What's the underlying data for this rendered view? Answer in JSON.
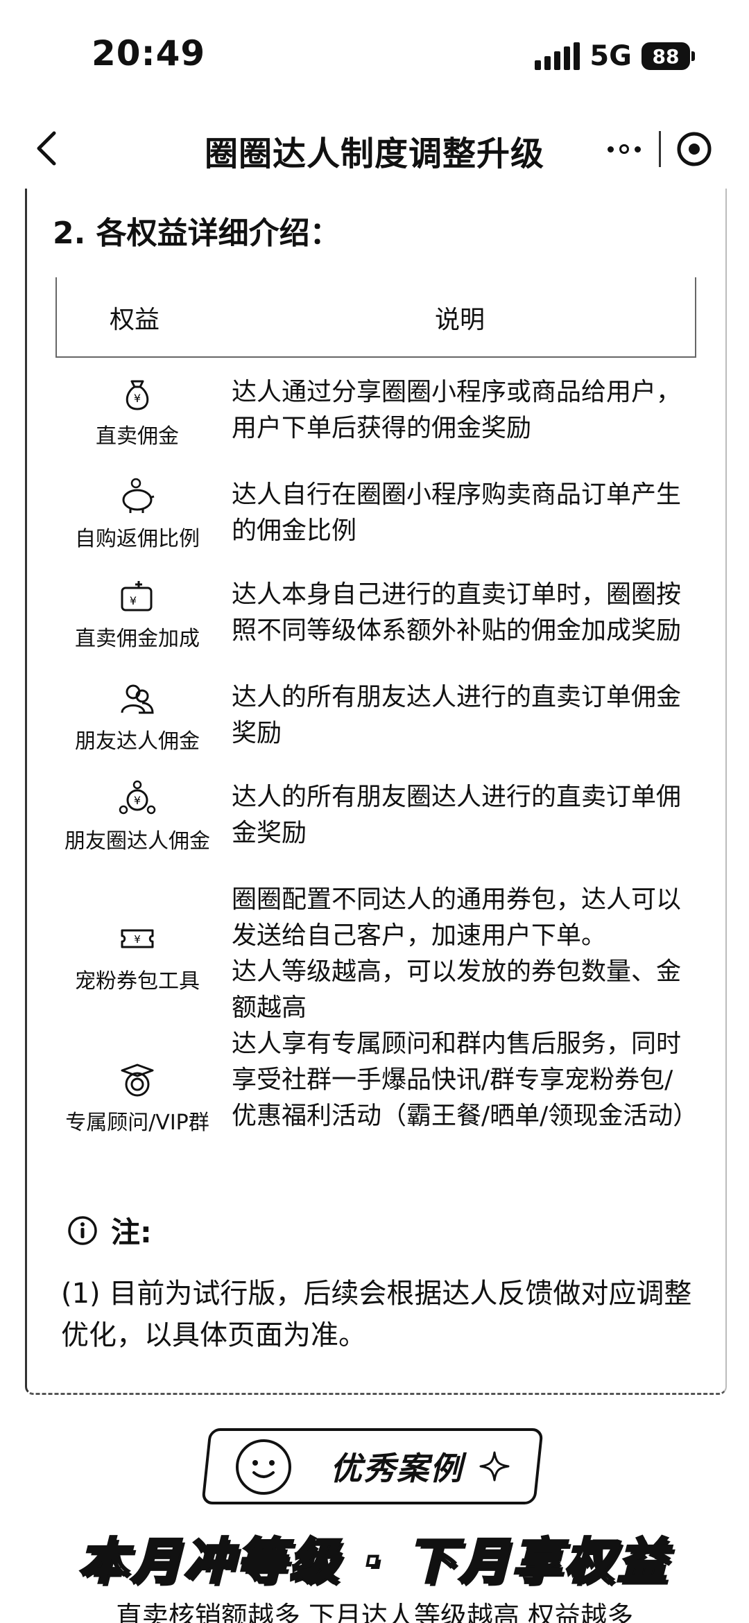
{
  "status_bar": {
    "time": "20:49",
    "network": "5G",
    "battery": "88"
  },
  "nav": {
    "title": "圈圈达人制度调整升级"
  },
  "section": {
    "title": "2. 各权益详细介绍："
  },
  "table": {
    "headers": [
      "权益",
      "说明"
    ],
    "rows": [
      {
        "name": "直卖佣金",
        "icon": "money-bag-icon",
        "desc": "达人通过分享圈圈小程序或商品给用户，用户下单后获得的佣金奖励"
      },
      {
        "name": "自购返佣比例",
        "icon": "piggy-bank-icon",
        "desc": "达人自行在圈圈小程序购卖商品订单产生的佣金比例"
      },
      {
        "name": "直卖佣金加成",
        "icon": "wallet-plus-icon",
        "desc": "达人本身自己进行的直卖订单时，圈圈按照不同等级体系额外补贴的佣金加成奖励"
      },
      {
        "name": "朋友达人佣金",
        "icon": "friends-icon",
        "desc": "达人的所有朋友达人进行的直卖订单佣金奖励"
      },
      {
        "name": "朋友圈达人佣金",
        "icon": "network-money-icon",
        "desc": "达人的所有朋友圈达人进行的直卖订单佣金奖励"
      },
      {
        "name": "宠粉券包工具",
        "icon": "coupon-icon",
        "desc": "圈圈配置不同达人的通用券包，达人可以发送给自己客户，加速用户下单。\n达人等级越高，可以发放的券包数量、金额越高"
      },
      {
        "name": "专属顾问/VIP群",
        "icon": "advisor-icon",
        "desc": "达人享有专属顾问和群内售后服务，同时享受社群一手爆品快讯/群专享宠粉券包/优惠福利活动（霸王餐/晒单/领现金活动）"
      }
    ]
  },
  "note": {
    "label": "注:",
    "text": "(1) 目前为试行版，后续会根据达人反馈做对应调整优化，以具体页面为准。"
  },
  "banner": {
    "badge": "优秀案例",
    "slogan": "本月冲等级 · 下月享权益",
    "subtitle": "直卖核销额越多 下月达人等级越高 权益越多"
  }
}
